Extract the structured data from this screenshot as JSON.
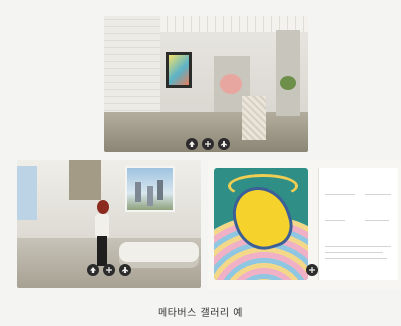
{
  "caption": "메타버스 갤러리 예",
  "views": {
    "top": {
      "controls": [
        "up-icon",
        "crosshair-icon",
        "person-icon"
      ]
    },
    "bottom_left": {
      "controls": [
        "up-icon",
        "crosshair-icon",
        "person-icon"
      ]
    },
    "bottom_right": {
      "controls": [
        "crosshair-icon"
      ],
      "info": {
        "fields": [
          {
            "label": "",
            "value": ""
          },
          {
            "label": "",
            "value": ""
          },
          {
            "label": "",
            "value": ""
          },
          {
            "label": "",
            "value": ""
          },
          {
            "label": "",
            "value": ""
          }
        ]
      }
    }
  },
  "colors": {
    "background": "#f4f4f3",
    "icon_bg": "#2b2b2b",
    "caption_text": "#333333"
  }
}
